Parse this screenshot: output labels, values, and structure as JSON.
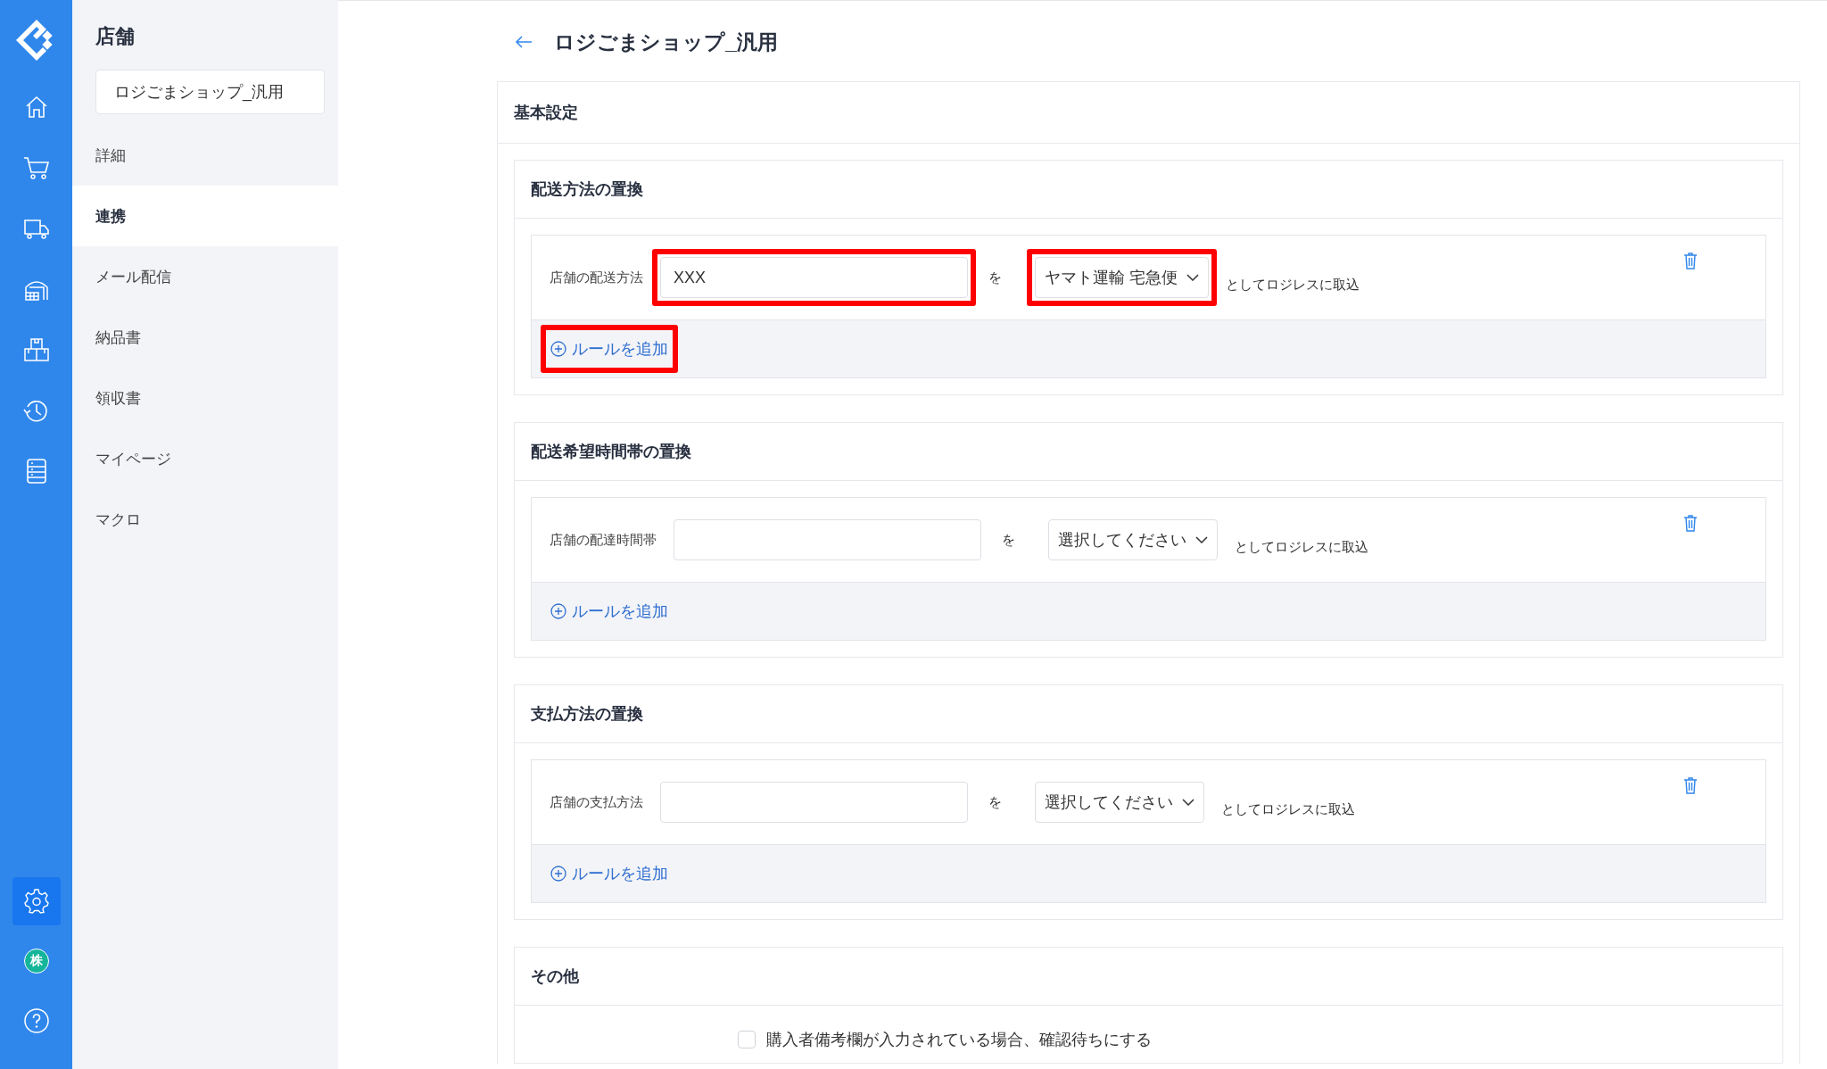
{
  "rail": {
    "top": [
      {
        "kind": "home",
        "selected": false
      },
      {
        "kind": "cart",
        "selected": false
      },
      {
        "kind": "truck",
        "selected": false
      },
      {
        "kind": "warehouse",
        "selected": false
      },
      {
        "kind": "boxes",
        "selected": false
      },
      {
        "kind": "history",
        "selected": false
      },
      {
        "kind": "list",
        "selected": false
      }
    ],
    "bottom": [
      {
        "kind": "gear",
        "selected": true
      },
      {
        "kind": "avatar",
        "selected": false,
        "text": "株"
      },
      {
        "kind": "help",
        "selected": false
      }
    ]
  },
  "nav": {
    "title": "店舗",
    "shop": "ロジごまショップ_汎用",
    "items": [
      {
        "label": "詳細",
        "selected": false
      },
      {
        "label": "連携",
        "selected": true
      },
      {
        "label": "メール配信",
        "selected": false
      },
      {
        "label": "納品書",
        "selected": false
      },
      {
        "label": "領収書",
        "selected": false
      },
      {
        "label": "マイページ",
        "selected": false
      },
      {
        "label": "マクロ",
        "selected": false
      }
    ]
  },
  "page": {
    "title": "ロジごまショップ_汎用",
    "card_title": "基本設定",
    "sections": [
      {
        "title": "配送方法の置換",
        "rules": [
          {
            "label": "店舗の配送方法",
            "value": "XXX",
            "value_highlighted": true,
            "connector": "を",
            "select": "ヤマト運輸 宅急便",
            "select_highlighted": true,
            "suffix": "としてロジレスに取込"
          }
        ],
        "add": "ルールを追加",
        "add_highlighted": true
      },
      {
        "title": "配送希望時間帯の置換",
        "rules": [
          {
            "label": "店舗の配達時間帯",
            "value_highlighted": false,
            "connector": "を",
            "select": "選択してください",
            "select_highlighted": false,
            "suffix": "としてロジレスに取込"
          }
        ],
        "add": "ルールを追加",
        "add_highlighted": false
      },
      {
        "title": "支払方法の置換",
        "rules": [
          {
            "label": "店舗の支払方法",
            "value_highlighted": false,
            "connector": "を",
            "select": "選択してください",
            "select_highlighted": false,
            "suffix": "としてロジレスに取込"
          }
        ],
        "add": "ルールを追加",
        "add_highlighted": false
      }
    ],
    "other": {
      "title": "その他",
      "checkbox": {
        "label": "購入者備考欄が入力されている場合、確認待ちにする",
        "checked": false
      }
    }
  }
}
